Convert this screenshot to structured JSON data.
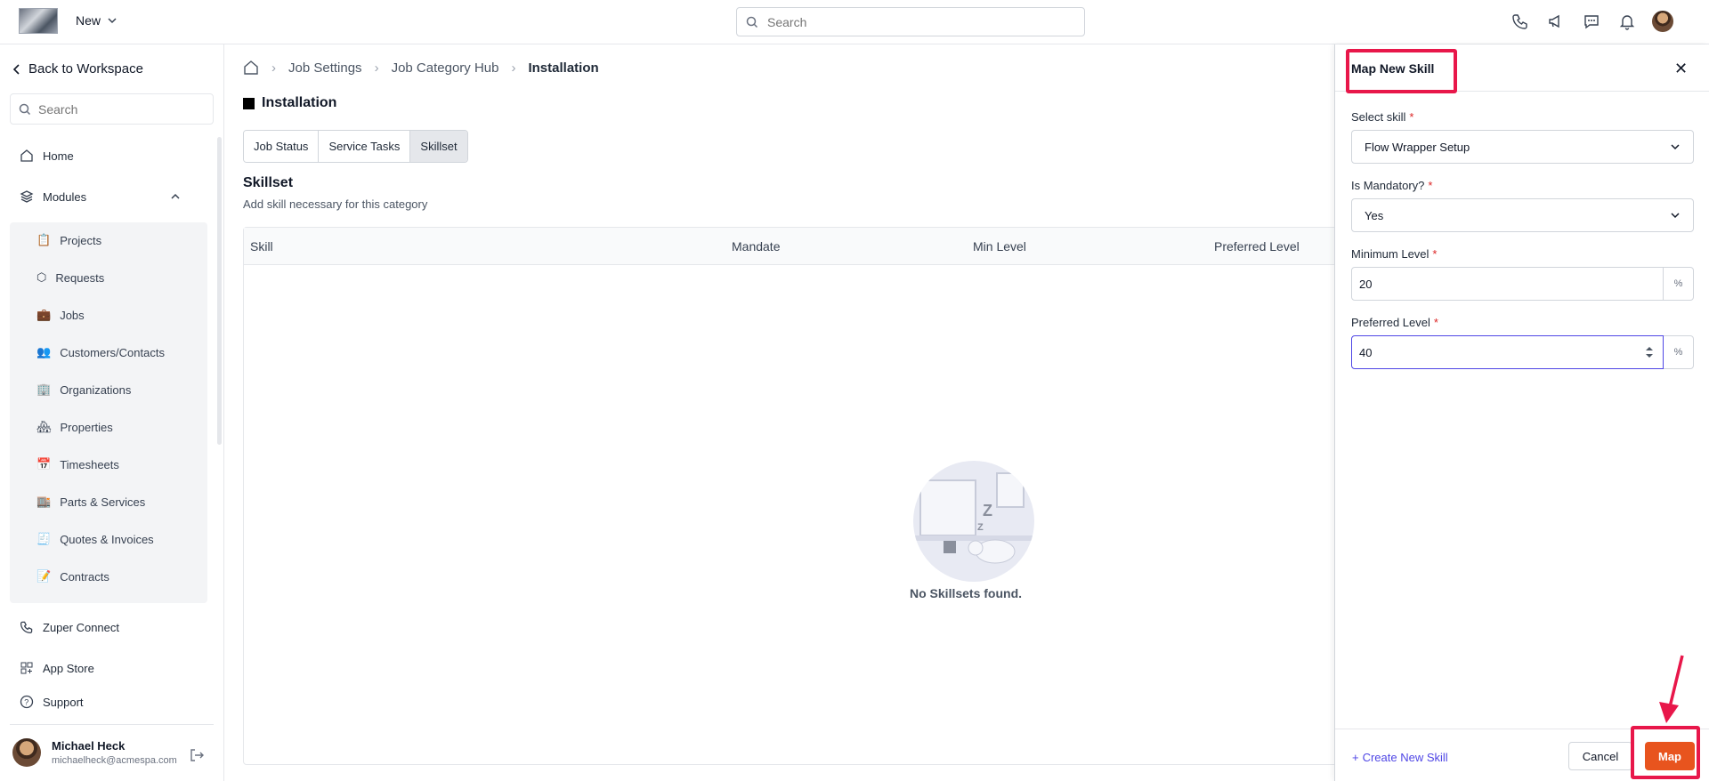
{
  "topbar": {
    "new_label": "New",
    "search_placeholder": "Search"
  },
  "sidebar": {
    "back_label": "Back to Workspace",
    "search_placeholder": "Search",
    "home": "Home",
    "modules": "Modules",
    "module_items": [
      "Projects",
      "Requests",
      "Jobs",
      "Customers/Contacts",
      "Organizations",
      "Properties",
      "Timesheets",
      "Parts & Services",
      "Quotes & Invoices",
      "Contracts"
    ],
    "zuper_connect": "Zuper Connect",
    "app_store": "App Store",
    "support": "Support",
    "user": {
      "name": "Michael Heck",
      "email": "michaelheck@acmespa.com"
    }
  },
  "main": {
    "breadcrumb": [
      "Job Settings",
      "Job Category Hub",
      "Installation"
    ],
    "title": "Installation",
    "tabs": [
      "Job Status",
      "Service Tasks",
      "Skillset"
    ],
    "section_title": "Skillset",
    "section_sub": "Add skill necessary for this category",
    "columns": [
      "Skill",
      "Mandate",
      "Min Level",
      "Preferred Level"
    ],
    "empty_text": "No Skillsets found."
  },
  "panel": {
    "title": "Map New Skill",
    "select_skill_label": "Select skill",
    "select_skill_value": "Flow Wrapper Setup",
    "mandatory_label": "Is Mandatory?",
    "mandatory_value": "Yes",
    "min_level_label": "Minimum Level",
    "min_level_value": "20",
    "pref_level_label": "Preferred Level",
    "pref_level_value": "40",
    "percent": "%",
    "required_mark": "*",
    "create_label": "Create New Skill",
    "cancel_label": "Cancel",
    "map_label": "Map"
  },
  "colors": {
    "accent": "#e8541e",
    "highlight": "#e8174a",
    "link": "#4f46e5"
  }
}
